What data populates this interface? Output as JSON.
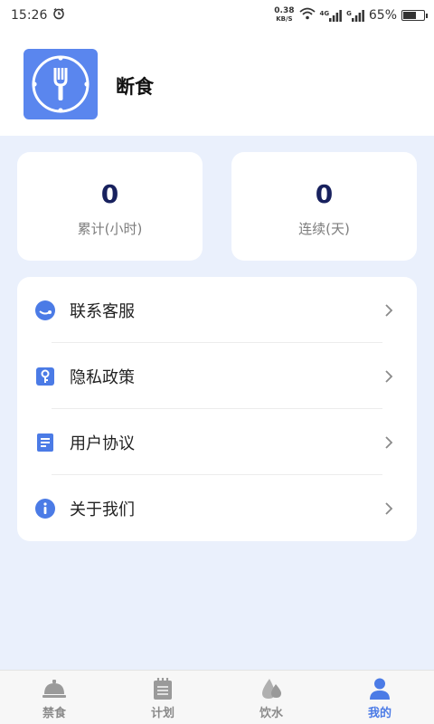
{
  "status_bar": {
    "time": "15:26",
    "net_speed": "0.38",
    "net_unit": "KB/S",
    "sig1_label": "4G",
    "sig2_label": "G",
    "battery": "65%",
    "battery_level": 0.65
  },
  "header": {
    "title": "断食"
  },
  "stats": [
    {
      "value": "0",
      "label": "累计(小时)"
    },
    {
      "value": "0",
      "label": "连续(天)"
    }
  ],
  "menu": [
    {
      "label": "联系客服",
      "icon": "customer-service-icon"
    },
    {
      "label": "隐私政策",
      "icon": "key-icon"
    },
    {
      "label": "用户协议",
      "icon": "document-icon"
    },
    {
      "label": "关于我们",
      "icon": "info-icon"
    }
  ],
  "tabs": [
    {
      "label": "禁食",
      "icon": "fasting-icon",
      "active": false
    },
    {
      "label": "计划",
      "icon": "calendar-icon",
      "active": false
    },
    {
      "label": "饮水",
      "icon": "water-drop-icon",
      "active": false
    },
    {
      "label": "我的",
      "icon": "user-icon",
      "active": true
    }
  ],
  "colors": {
    "accent": "#4b7be6",
    "logo_bg": "#5a86ee",
    "page_bg": "#eaf0fc",
    "stat_value": "#18215e"
  }
}
